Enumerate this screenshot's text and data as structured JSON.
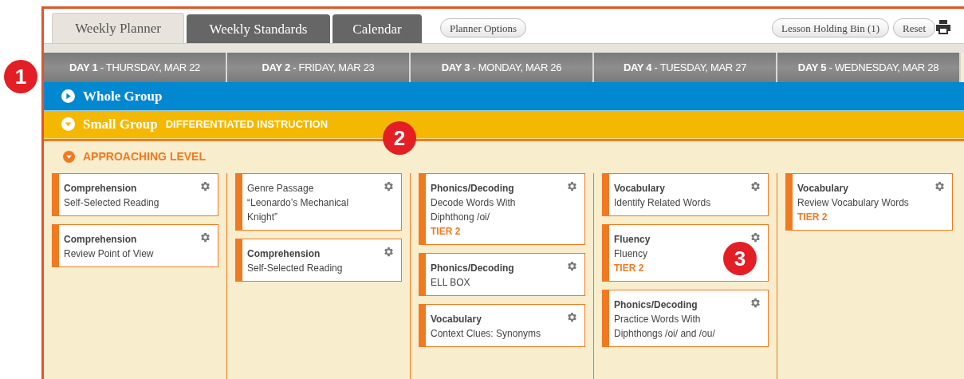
{
  "tabs": [
    {
      "label": "Weekly Planner",
      "selected": true
    },
    {
      "label": "Weekly Standards",
      "selected": false
    },
    {
      "label": "Calendar",
      "selected": false
    }
  ],
  "planner_options_button": "Planner Options",
  "toolbar_buttons": [
    "Lesson Holding Bin (1)",
    "Reset"
  ],
  "days": [
    "**DAY 1** - THURSDAY, MAR 22",
    "**DAY 2** - FRIDAY, MAR 23",
    "**DAY 3** - MONDAY, MAR 26",
    "**DAY 4** - TUESDAY, MAR 27",
    "**DAY 5** - WEDNESDAY, MAR 28"
  ],
  "groups": [
    {
      "title": "Whole Group",
      "expanded": false,
      "color": "#0288d1"
    },
    {
      "title": "Small Group",
      "subtitle": "DIFFERENTIATED INSTRUCTION",
      "expanded": true,
      "color": "#f5b800"
    }
  ],
  "level_section": {
    "title": "APPROACHING LEVEL",
    "expanded": true
  },
  "columns": [
    {
      "cards": [
        {
          "title": "Comprehension",
          "title_bold": true,
          "lines": [
            "Self-Selected Reading"
          ]
        },
        {
          "title": "Comprehension",
          "title_bold": true,
          "lines": [
            "Review Point of View"
          ]
        }
      ]
    },
    {
      "cards": [
        {
          "title": "Genre Passage",
          "title_bold": false,
          "lines": [
            "“Leonardo’s Mechanical Knight”"
          ]
        },
        {
          "title": "Comprehension",
          "title_bold": true,
          "lines": [
            "Self-Selected Reading"
          ]
        }
      ]
    },
    {
      "cards": [
        {
          "title": "Phonics/Decoding",
          "title_bold": true,
          "lines": [
            "Decode Words With Diphthong /oi/"
          ],
          "tier": "TIER 2"
        },
        {
          "title": "Phonics/Decoding",
          "title_bold": true,
          "lines": [
            "ELL BOX"
          ]
        },
        {
          "title": "Vocabulary",
          "title_bold": true,
          "lines": [
            "Context Clues: Synonyms"
          ]
        }
      ]
    },
    {
      "cards": [
        {
          "title": "Vocabulary",
          "title_bold": true,
          "lines": [
            "Identify Related Words"
          ]
        },
        {
          "title": "Fluency",
          "title_bold": true,
          "lines": [
            "Fluency"
          ],
          "tier": "TIER 2"
        },
        {
          "title": "Phonics/Decoding",
          "title_bold": true,
          "lines": [
            "Practice Words With Diphthongs /oi/ and /ou/"
          ]
        }
      ]
    },
    {
      "cards": [
        {
          "title": "Vocabulary",
          "title_bold": true,
          "lines": [
            "Review Vocabulary Words"
          ],
          "tier": "TIER 2"
        }
      ]
    }
  ],
  "callouts": [
    "1",
    "2",
    "3"
  ]
}
